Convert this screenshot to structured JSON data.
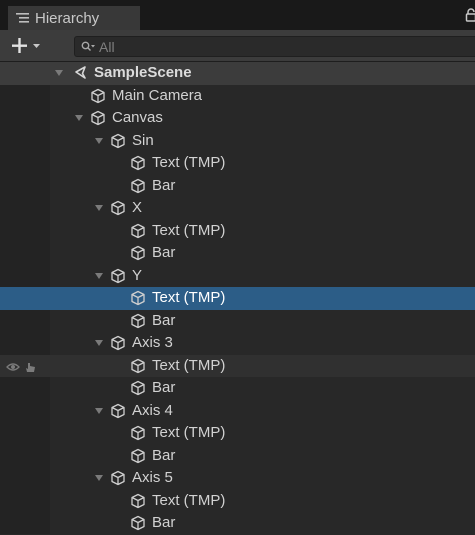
{
  "window": {
    "tab_title": "Hierarchy",
    "search_placeholder": "All"
  },
  "scene": {
    "name": "SampleScene"
  },
  "objects": [
    {
      "label": "Main Camera",
      "depth": 1,
      "expanded": false
    },
    {
      "label": "Canvas",
      "depth": 1,
      "expanded": true
    },
    {
      "label": "Sin",
      "depth": 2,
      "expanded": true
    },
    {
      "label": "Text (TMP)",
      "depth": 3
    },
    {
      "label": "Bar",
      "depth": 3
    },
    {
      "label": "X",
      "depth": 2,
      "expanded": true
    },
    {
      "label": "Text (TMP)",
      "depth": 3
    },
    {
      "label": "Bar",
      "depth": 3
    },
    {
      "label": "Y",
      "depth": 2,
      "expanded": true
    },
    {
      "label": "Text (TMP)",
      "depth": 3,
      "selected": true
    },
    {
      "label": "Bar",
      "depth": 3
    },
    {
      "label": "Axis 3",
      "depth": 2,
      "expanded": true
    },
    {
      "label": "Text (TMP)",
      "depth": 3,
      "hovered": true
    },
    {
      "label": "Bar",
      "depth": 3
    },
    {
      "label": "Axis 4",
      "depth": 2,
      "expanded": true
    },
    {
      "label": "Text (TMP)",
      "depth": 3
    },
    {
      "label": "Bar",
      "depth": 3
    },
    {
      "label": "Axis 5",
      "depth": 2,
      "expanded": true
    },
    {
      "label": "Text (TMP)",
      "depth": 3
    },
    {
      "label": "Bar",
      "depth": 3
    }
  ],
  "icons": {
    "tab": "hierarchy-list-icon",
    "lock": "lock-icon",
    "add": "plus-dropdown-icon",
    "search": "search-filter-icon",
    "scene": "unity-scene-icon",
    "gameobject": "cube-icon",
    "visibility": "eye-icon",
    "pickability": "hand-pointer-icon"
  },
  "colors": {
    "selected_row": "#2c5d87",
    "scene_row": "#3c3c3c",
    "panel": "#282828"
  }
}
